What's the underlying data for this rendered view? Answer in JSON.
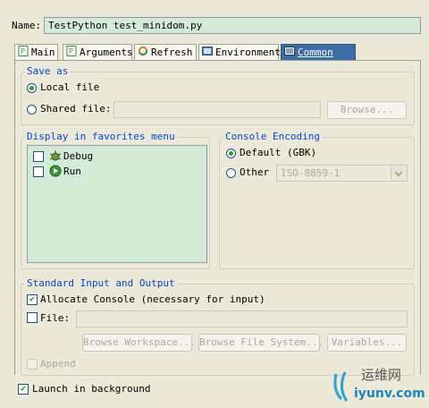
{
  "name_label": "Name:",
  "name_value": "TestPython test_minidom.py",
  "tabs": [
    {
      "label": "Main"
    },
    {
      "label": "Arguments"
    },
    {
      "label": "Refresh"
    },
    {
      "label": "Environment"
    },
    {
      "label": "Common"
    }
  ],
  "save_as": {
    "title": "Save as",
    "local_file": "Local file",
    "shared_file": "Shared file:",
    "browse": "Browse..."
  },
  "favorites": {
    "title": "Display in favorites menu",
    "items": [
      {
        "label": "Debug"
      },
      {
        "label": "Run"
      }
    ]
  },
  "encoding": {
    "title": "Console Encoding",
    "default": "Default (GBK)",
    "other": "Other",
    "other_value": "ISO-8859-1"
  },
  "std_io": {
    "title": "Standard Input and Output",
    "allocate_console": "Allocate Console (necessary for input)",
    "file": "File:",
    "browse_workspace": "Browse Workspace...",
    "browse_file_system": "Browse File System...",
    "variables": "Variables...",
    "append": "Append"
  },
  "launch_background": "Launch in background",
  "watermark": {
    "cn": "运维网",
    "url": "iyunv.com"
  }
}
